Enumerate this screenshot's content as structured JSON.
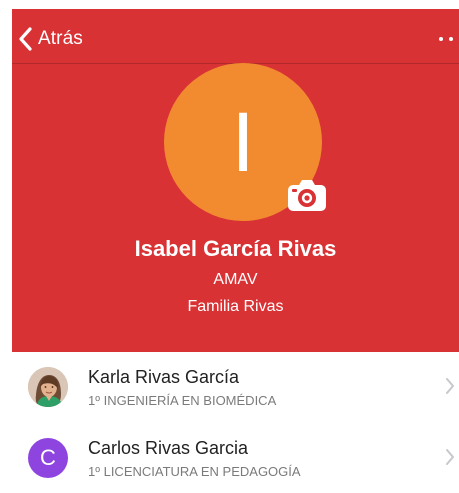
{
  "colors": {
    "header_background": "#d93235",
    "avatar_background": "#f28a30",
    "contact_letter_avatar": "#8e44de",
    "primary_text": "#222222",
    "secondary_text": "#7a7a7a"
  },
  "nav": {
    "back_label": "Atrás",
    "back_icon": "chevron-left-icon",
    "more_icon": "more-dots-icon"
  },
  "profile": {
    "initial": "I",
    "name": "Isabel García Rivas",
    "organization": "AMAV",
    "family": "Familia Rivas",
    "camera_icon": "camera-icon"
  },
  "contacts": [
    {
      "name": "Karla Rivas García",
      "program": "1º INGENIERÍA EN BIOMÉDICA",
      "avatar_type": "photo",
      "chevron_icon": "chevron-right-icon"
    },
    {
      "name": "Carlos Rivas Garcia",
      "program": "1º LICENCIATURA EN PEDAGOGÍA",
      "avatar_type": "letter",
      "initial": "C",
      "chevron_icon": "chevron-right-icon"
    }
  ]
}
